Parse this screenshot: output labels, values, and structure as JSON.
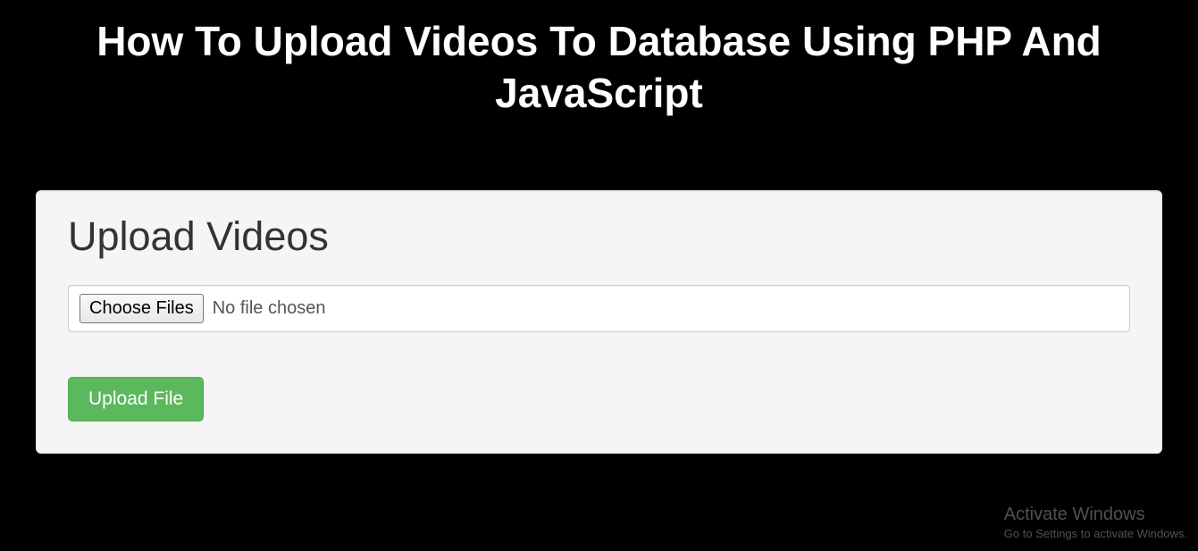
{
  "header": {
    "title": "How To Upload Videos To Database Using PHP And JavaScript"
  },
  "panel": {
    "heading": "Upload Videos",
    "file_input": {
      "button_label": "Choose Files",
      "status_text": "No file chosen"
    },
    "submit_label": "Upload File"
  },
  "watermark": {
    "title": "Activate Windows",
    "subtitle": "Go to Settings to activate Windows."
  }
}
